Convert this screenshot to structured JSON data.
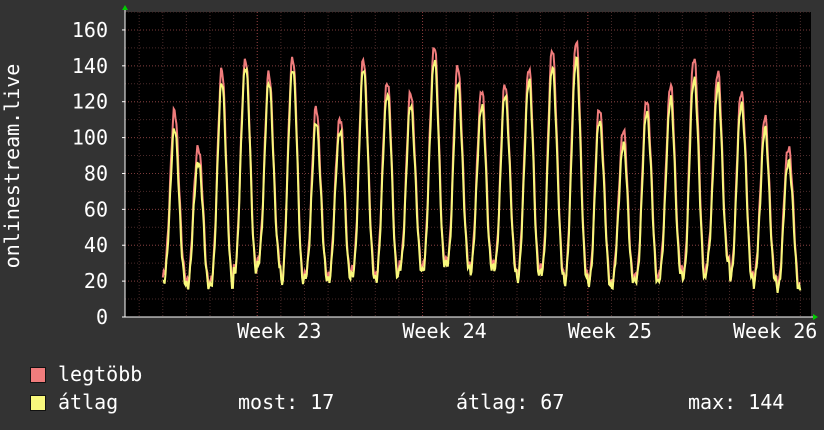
{
  "chart_data": {
    "type": "line",
    "ylabel": "onlinestream.live",
    "ylim": [
      0,
      170
    ],
    "yticks": [
      0,
      20,
      40,
      60,
      80,
      100,
      120,
      140,
      160
    ],
    "grid": true,
    "x_week_labels": [
      "Week 23",
      "Week 24",
      "Week 25",
      "Week 26"
    ],
    "x_week_positions": [
      23,
      24,
      25,
      26
    ],
    "xlim": [
      22.2,
      26.35
    ],
    "day_positions": [
      22.5,
      22.643,
      22.786,
      22.929,
      23.071,
      23.214,
      23.357,
      23.5,
      23.643,
      23.786,
      23.929,
      24.071,
      24.214,
      24.357,
      24.5,
      24.643,
      24.786,
      24.929,
      25.071,
      25.214,
      25.357,
      25.5,
      25.643,
      25.786,
      25.929,
      26.071,
      26.214
    ],
    "series": [
      {
        "name": "legtöbb",
        "color": "#f07c7c",
        "daily_peaks": [
          114,
          96,
          137,
          145,
          135,
          146,
          116,
          112,
          143,
          132,
          125,
          152,
          140,
          127,
          130,
          139,
          150,
          154,
          117,
          104,
          122,
          129,
          146,
          136,
          127,
          111,
          96
        ],
        "daily_lows": [
          22,
          20,
          18,
          28,
          30,
          22,
          22,
          24,
          25,
          24,
          28,
          30,
          30,
          28,
          28,
          25,
          26,
          22,
          20,
          20,
          22,
          25,
          25,
          30,
          24,
          20,
          18
        ]
      },
      {
        "name": "átlag",
        "color": "#f8f87c",
        "daily_peaks": [
          104,
          88,
          130,
          141,
          130,
          140,
          108,
          105,
          138,
          125,
          118,
          144,
          131,
          118,
          124,
          132,
          140,
          144,
          110,
          96,
          115,
          121,
          134,
          128,
          120,
          104,
          88
        ],
        "daily_lows": [
          18,
          18,
          16,
          26,
          28,
          20,
          21,
          22,
          22,
          22,
          26,
          28,
          28,
          26,
          26,
          22,
          24,
          20,
          18,
          18,
          20,
          22,
          22,
          28,
          22,
          18,
          16
        ]
      }
    ]
  },
  "legend": [
    {
      "label": "legtöbb",
      "color": "#f07c7c"
    },
    {
      "label": "átlag",
      "color": "#f8f87c"
    }
  ],
  "stats": {
    "current": "most: 17",
    "average": "átlag: 67",
    "max": "max: 144"
  }
}
